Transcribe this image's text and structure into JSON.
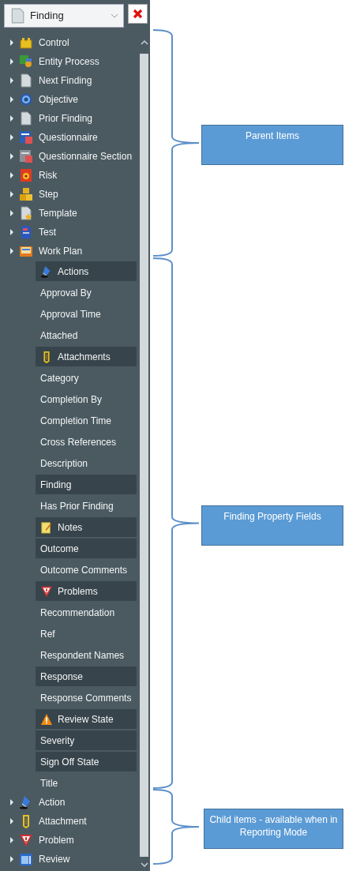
{
  "dropdown": {
    "value": "Finding"
  },
  "parent_items": [
    {
      "label": "Control",
      "kind": "box"
    },
    {
      "label": "Entity Process",
      "kind": "process"
    },
    {
      "label": "Next Finding",
      "kind": "page"
    },
    {
      "label": "Objective",
      "kind": "gear"
    },
    {
      "label": "Prior Finding",
      "kind": "page"
    },
    {
      "label": "Questionnaire",
      "kind": "form"
    },
    {
      "label": "Questionnaire Section",
      "kind": "formgray"
    },
    {
      "label": "Risk",
      "kind": "hazard"
    },
    {
      "label": "Step",
      "kind": "blocks"
    },
    {
      "label": "Template",
      "kind": "starpage"
    },
    {
      "label": "Test",
      "kind": "testpage"
    },
    {
      "label": "Work Plan",
      "kind": "book"
    }
  ],
  "fields": [
    {
      "label": "Actions",
      "highlighted": true,
      "kind": "pen"
    },
    {
      "label": "Approval By",
      "highlighted": false,
      "kind": "plain"
    },
    {
      "label": "Approval Time",
      "highlighted": false,
      "kind": "plain"
    },
    {
      "label": "Attached",
      "highlighted": false,
      "kind": "plain"
    },
    {
      "label": "Attachments",
      "highlighted": true,
      "kind": "clip"
    },
    {
      "label": "Category",
      "highlighted": false,
      "kind": "plain"
    },
    {
      "label": "Completion By",
      "highlighted": false,
      "kind": "plain"
    },
    {
      "label": "Completion Time",
      "highlighted": false,
      "kind": "plain"
    },
    {
      "label": "Cross References",
      "highlighted": false,
      "kind": "plain"
    },
    {
      "label": "Description",
      "highlighted": false,
      "kind": "plain"
    },
    {
      "label": "Finding",
      "highlighted": true,
      "kind": "plain"
    },
    {
      "label": "Has Prior Finding",
      "highlighted": false,
      "kind": "plain"
    },
    {
      "label": "Notes",
      "highlighted": true,
      "kind": "note"
    },
    {
      "label": "Outcome",
      "highlighted": true,
      "kind": "plain"
    },
    {
      "label": "Outcome Comments",
      "highlighted": false,
      "kind": "plain"
    },
    {
      "label": "Problems",
      "highlighted": true,
      "kind": "problem"
    },
    {
      "label": "Recommendation",
      "highlighted": false,
      "kind": "plain"
    },
    {
      "label": "Ref",
      "highlighted": false,
      "kind": "plain"
    },
    {
      "label": "Respondent Names",
      "highlighted": false,
      "kind": "plain"
    },
    {
      "label": "Response",
      "highlighted": true,
      "kind": "plain"
    },
    {
      "label": "Response Comments",
      "highlighted": false,
      "kind": "plain"
    },
    {
      "label": "Review State",
      "highlighted": true,
      "kind": "alert"
    },
    {
      "label": "Severity",
      "highlighted": true,
      "kind": "plain"
    },
    {
      "label": "Sign Off State",
      "highlighted": true,
      "kind": "plain"
    },
    {
      "label": "Title",
      "highlighted": false,
      "kind": "plain"
    }
  ],
  "child_items": [
    {
      "label": "Action",
      "kind": "pen"
    },
    {
      "label": "Attachment",
      "kind": "clip"
    },
    {
      "label": "Problem",
      "kind": "problem"
    },
    {
      "label": "Review",
      "kind": "panel"
    }
  ],
  "callouts": [
    {
      "text": "Parent Items"
    },
    {
      "text": "Finding Property Fields"
    },
    {
      "text": "Child items - available when in Reporting Mode"
    }
  ]
}
